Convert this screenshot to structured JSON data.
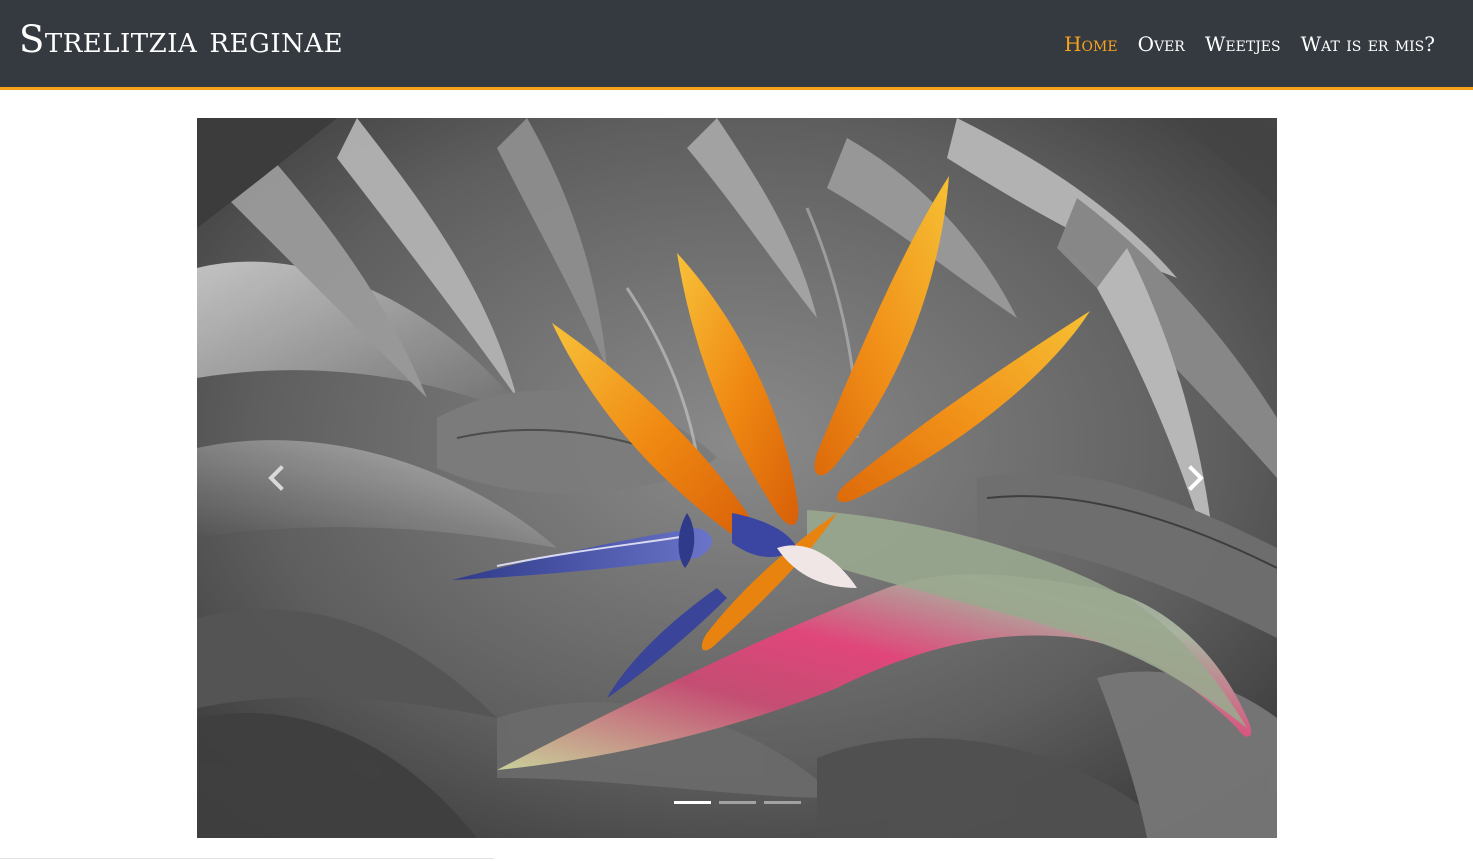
{
  "header": {
    "brand": "Strelitzia reginae",
    "accent_color": "#f7a21b",
    "background_color": "#343a40"
  },
  "nav": {
    "items": [
      {
        "label": "Home",
        "active": true
      },
      {
        "label": "Over",
        "active": false
      },
      {
        "label": "Weetjes",
        "active": false
      },
      {
        "label": "Wat is er mis?",
        "active": false
      }
    ]
  },
  "carousel": {
    "slide_count": 3,
    "active_index": 0,
    "image_subject": "bird-of-paradise-flower",
    "prev_icon": "chevron-left-icon",
    "next_icon": "chevron-right-icon"
  }
}
